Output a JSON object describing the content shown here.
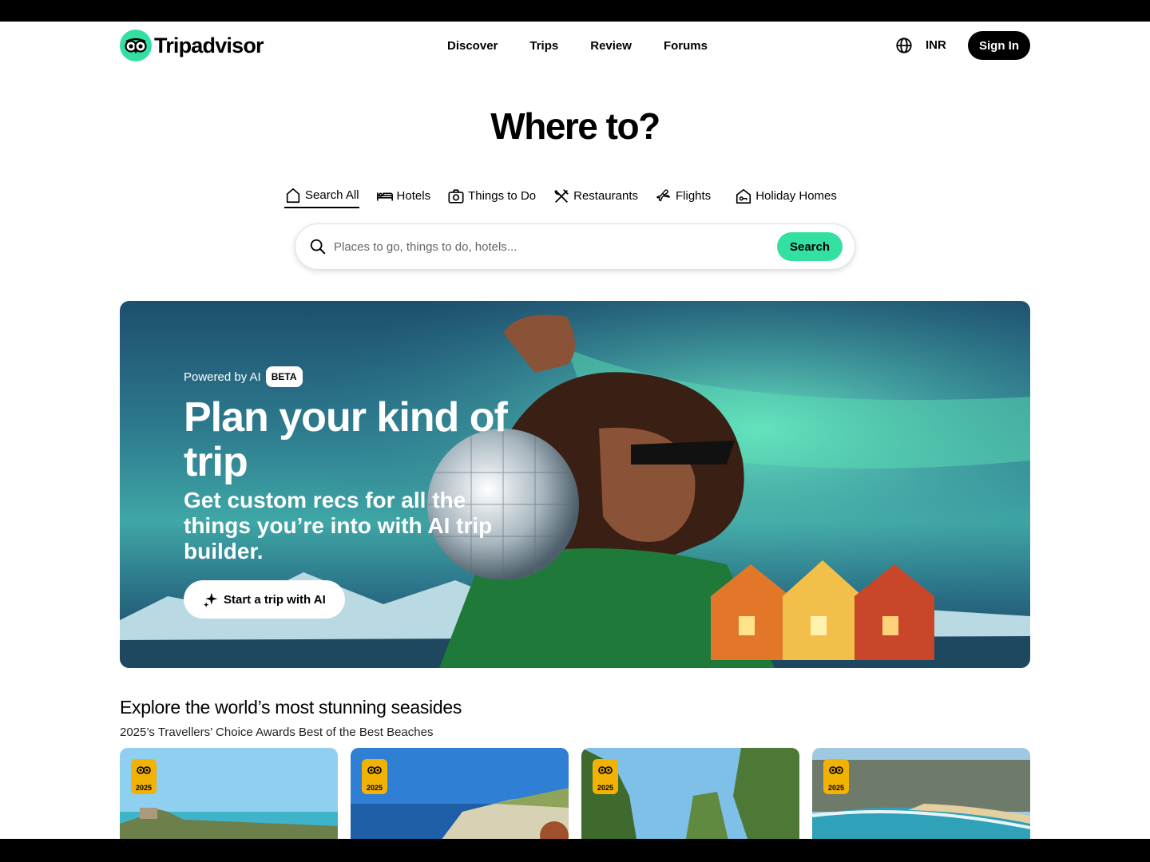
{
  "brand": {
    "name": "Tripadvisor",
    "accent": "#34e0a1"
  },
  "nav": {
    "items": [
      "Discover",
      "Trips",
      "Review",
      "Forums"
    ]
  },
  "header": {
    "currency": "INR",
    "signin_label": "Sign In",
    "globe_icon": "globe-icon"
  },
  "hero": {
    "title": "Where to?"
  },
  "tabs": [
    {
      "label": "Search All",
      "icon": "home-icon",
      "active": true
    },
    {
      "label": "Hotels",
      "icon": "bed-icon"
    },
    {
      "label": "Things to Do",
      "icon": "camera-icon"
    },
    {
      "label": "Restaurants",
      "icon": "utensils-icon"
    },
    {
      "label": "Flights",
      "icon": "plane-icon"
    },
    {
      "label": "Holiday Homes",
      "icon": "house-key-icon"
    }
  ],
  "search": {
    "placeholder": "Places to go, things to do, hotels...",
    "button_label": "Search"
  },
  "banner": {
    "powered_label": "Powered by AI",
    "beta_label": "BETA",
    "heading": "Plan your kind of trip",
    "subheading": "Get custom recs for all the things you’re into with AI trip builder.",
    "button_label": "Start a trip with AI"
  },
  "seaside": {
    "title": "Explore the world’s most stunning seasides",
    "subtitle": "2025’s Travellers’ Choice Awards Best of the Best Beaches",
    "cards": [
      {
        "award_year": "2025"
      },
      {
        "award_year": "2025"
      },
      {
        "award_year": "2025"
      },
      {
        "award_year": "2025"
      }
    ]
  }
}
